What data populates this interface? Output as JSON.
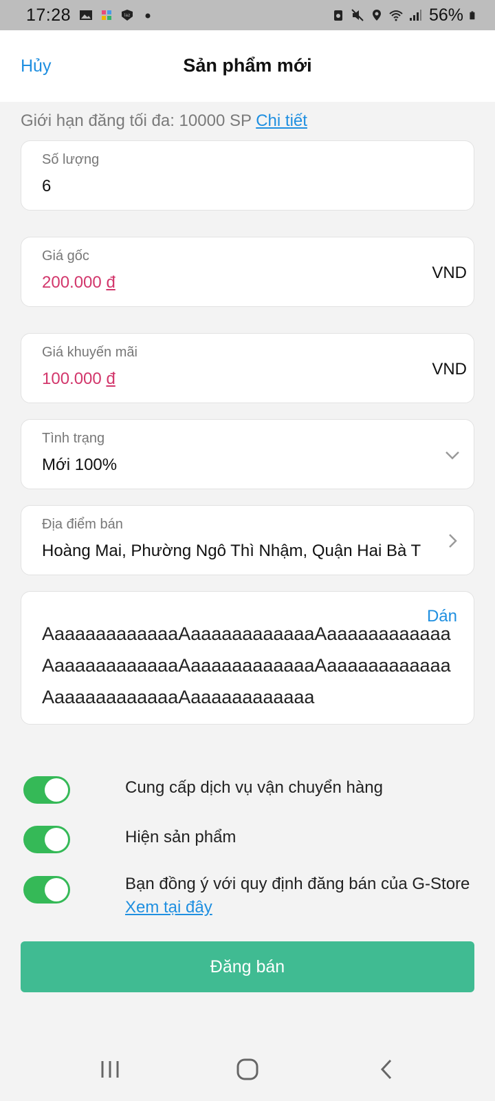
{
  "status_bar": {
    "time": "17:28",
    "battery": "56%"
  },
  "header": {
    "cancel_label": "Hủy",
    "title": "Sản phẩm mới"
  },
  "limit": {
    "text": "Giới hạn đăng tối đa: 10000 SP",
    "link": "Chi tiết"
  },
  "fields": {
    "quantity": {
      "label": "Số lượng",
      "value": "6"
    },
    "original_price": {
      "label": "Giá gốc",
      "value": "200.000",
      "currency_symbol": "đ",
      "unit": "VND"
    },
    "sale_price": {
      "label": "Giá khuyến mãi",
      "value": "100.000",
      "currency_symbol": "đ",
      "unit": "VND"
    },
    "condition": {
      "label": "Tình trạng",
      "value": "Mới 100%"
    },
    "location": {
      "label": "Địa điểm bán",
      "value": "Hoàng Mai, Phường Ngô Thì Nhậm, Quận Hai Bà T"
    }
  },
  "description": {
    "paste_label": "Dán",
    "text": "AaaaaaaaaaaaaAaaaaaaaaaaaaAaaaaaaaaaaaaAaaaaaaaaaaaaAaaaaaaaaaaaaAaaaaaaaaaaaaAaaaaaaaaaaaaAaaaaaaaaaaaa"
  },
  "toggles": [
    {
      "label": "Cung cấp dịch vụ vận chuyển hàng",
      "on": true
    },
    {
      "label": "Hiện sản phẩm",
      "on": true
    },
    {
      "label": "Bạn đồng ý với quy định đăng bán của G-Store",
      "link": "Xem tại đây",
      "on": true
    }
  ],
  "submit_label": "Đăng bán",
  "colors": {
    "accent_blue": "#1f8fe0",
    "price_pink": "#d2366b",
    "toggle_green": "#35b957",
    "submit_green": "#40bb92"
  }
}
